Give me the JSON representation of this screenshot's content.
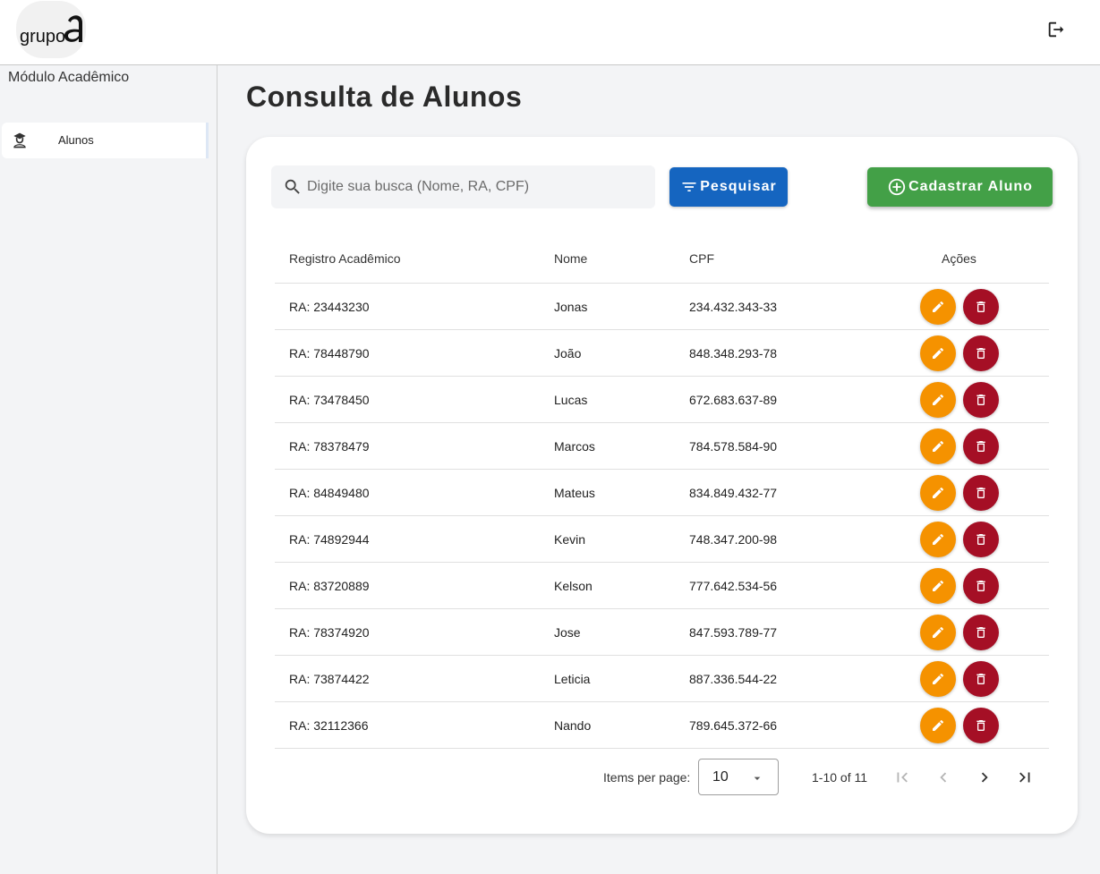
{
  "header": {
    "logo_text": "grupo a"
  },
  "sidebar": {
    "title": "Módulo Acadêmico",
    "items": [
      {
        "label": "Alunos",
        "icon": "school-person-icon"
      }
    ]
  },
  "main": {
    "title": "Consulta de Alunos",
    "search": {
      "placeholder": "Digite sua busca (Nome, RA, CPF)",
      "value": ""
    },
    "search_button_label": "Pesquisar",
    "add_button_label": "Cadastrar Aluno"
  },
  "table": {
    "headers": {
      "ra": "Registro Acadêmico",
      "nome": "Nome",
      "cpf": "CPF",
      "acoes": "Ações"
    },
    "rows": [
      {
        "ra": "RA: 23443230",
        "nome": "Jonas",
        "cpf": "234.432.343-33"
      },
      {
        "ra": "RA: 78448790",
        "nome": "João",
        "cpf": "848.348.293-78"
      },
      {
        "ra": "RA: 73478450",
        "nome": "Lucas",
        "cpf": "672.683.637-89"
      },
      {
        "ra": "RA: 78378479",
        "nome": "Marcos",
        "cpf": "784.578.584-90"
      },
      {
        "ra": "RA: 84849480",
        "nome": "Mateus",
        "cpf": "834.849.432-77"
      },
      {
        "ra": "RA: 74892944",
        "nome": "Kevin",
        "cpf": "748.347.200-98"
      },
      {
        "ra": "RA: 83720889",
        "nome": "Kelson",
        "cpf": "777.642.534-56"
      },
      {
        "ra": "RA: 78374920",
        "nome": "Jose",
        "cpf": "847.593.789-77"
      },
      {
        "ra": "RA: 73874422",
        "nome": "Leticia",
        "cpf": "887.336.544-22"
      },
      {
        "ra": "RA: 32112366",
        "nome": "Nando",
        "cpf": "789.645.372-66"
      }
    ]
  },
  "paginator": {
    "items_per_page_label": "Items per page:",
    "items_per_page": "10",
    "range_label": "1-10 of 11"
  },
  "colors": {
    "primary": "#1565c0",
    "success": "#43a047",
    "edit": "#f59200",
    "delete": "#a50f25"
  }
}
